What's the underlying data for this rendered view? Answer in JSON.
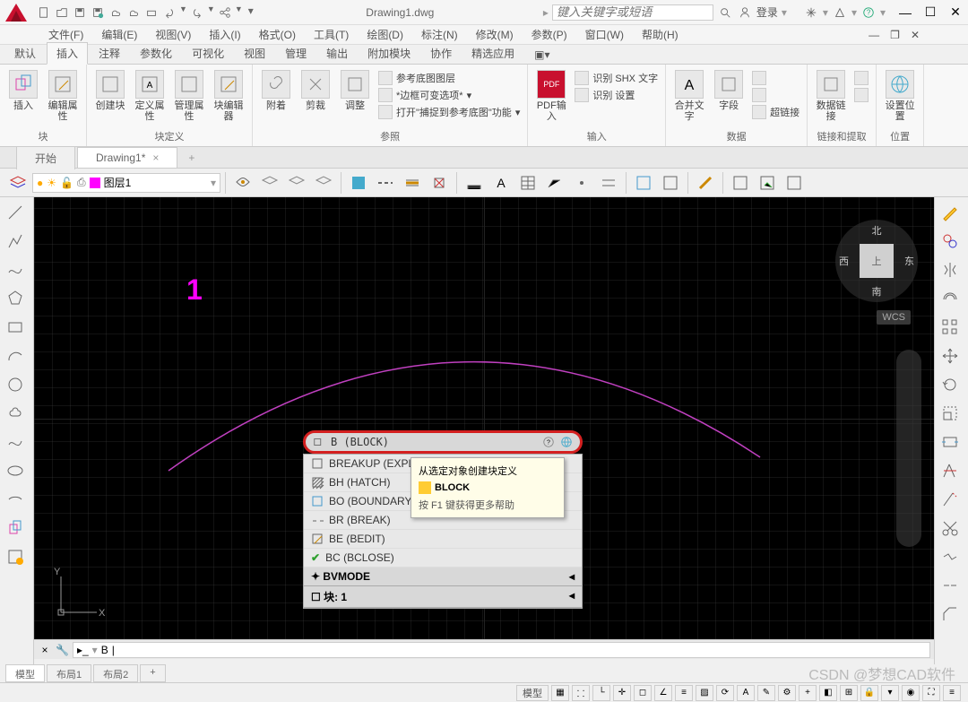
{
  "app": {
    "title": "Drawing1.dwg"
  },
  "titlebar": {
    "search_placeholder": "键入关键字或短语",
    "login": "登录"
  },
  "menubar": [
    "文件(F)",
    "编辑(E)",
    "视图(V)",
    "插入(I)",
    "格式(O)",
    "工具(T)",
    "绘图(D)",
    "标注(N)",
    "修改(M)",
    "参数(P)",
    "窗口(W)",
    "帮助(H)"
  ],
  "ribbon_tabs": [
    "默认",
    "插入",
    "注释",
    "参数化",
    "可视化",
    "视图",
    "管理",
    "输出",
    "附加模块",
    "协作",
    "精选应用"
  ],
  "ribbon_active": 1,
  "ribbon_groups": {
    "g1": {
      "label": "块",
      "btns": [
        "插入",
        "编辑属性"
      ]
    },
    "g2": {
      "label": "块定义",
      "btns": [
        "创建块",
        "定义属性",
        "管理属性",
        "块编辑器"
      ]
    },
    "g3": {
      "label": "参照",
      "btns": [
        "附着",
        "剪裁",
        "调整"
      ],
      "sm": [
        "参考底图图层",
        "*边框可变选项*",
        "打开\"捕捉到参考底图\"功能"
      ]
    },
    "g4": {
      "label": "输入",
      "btns": [
        "PDF输入"
      ],
      "sm": [
        "识别 SHX 文字",
        "识别 设置"
      ]
    },
    "g5": {
      "label": "数据",
      "btns": [
        "合并文字",
        "字段"
      ],
      "sm": [
        "超链接"
      ],
      "btn2": "数据链接"
    },
    "g6": {
      "label": "链接和提取"
    },
    "g7": {
      "label": "位置",
      "btns": [
        "设置位置"
      ]
    }
  },
  "doc_tabs": [
    {
      "label": "开始",
      "active": false
    },
    {
      "label": "Drawing1*",
      "active": true
    }
  ],
  "layer": {
    "current": "图层1"
  },
  "drawing": {
    "num": "1"
  },
  "viewcube": {
    "top": "北",
    "right": "东",
    "bottom": "南",
    "left": "西",
    "center": "上"
  },
  "wcs": "WCS",
  "autocomplete": {
    "head": "B (BLOCK)",
    "items": [
      "BREAKUP (EXPL",
      "BH (HATCH)",
      "BO (BOUNDARY)",
      "BR (BREAK)",
      "BE (BEDIT)",
      "BC (BCLOSE)"
    ],
    "sect1": "BVMODE",
    "sect2": "块: 1"
  },
  "tooltip": {
    "line1": "从选定对象创建块定义",
    "title": "BLOCK",
    "help": "按 F1 键获得更多帮助"
  },
  "cmdline": {
    "prompt": "B"
  },
  "layout_tabs": [
    "模型",
    "布局1",
    "布局2"
  ],
  "statusbar": {
    "model": "模型"
  },
  "watermark": "CSDN @梦想CAD软件"
}
